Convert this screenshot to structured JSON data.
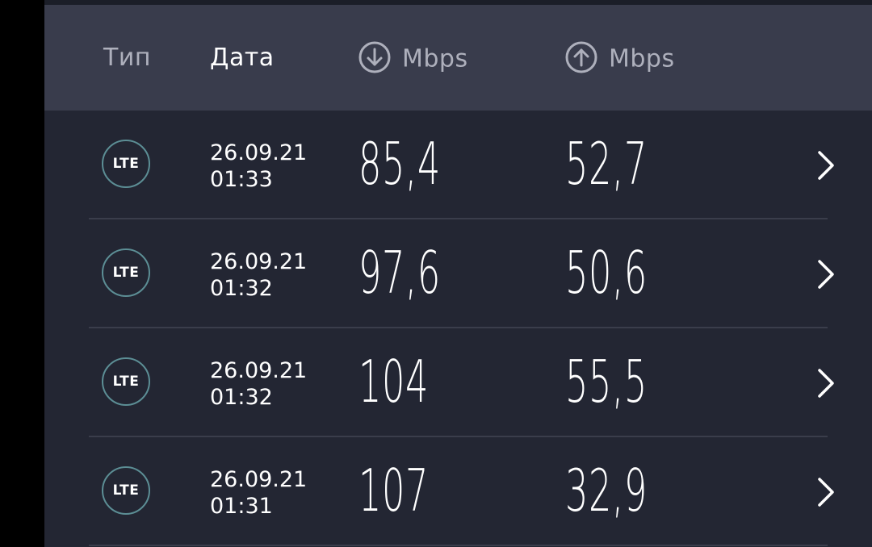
{
  "header": {
    "type_label": "Тип",
    "date_label": "Дата",
    "download_label": "Mbps",
    "download_icon": "arrow-down-circle-icon",
    "upload_label": "Mbps",
    "upload_icon": "arrow-up-circle-icon"
  },
  "results": [
    {
      "type": "LTE",
      "date": "26.09.21",
      "time": "01:33",
      "download": "85,4",
      "upload": "52,7"
    },
    {
      "type": "LTE",
      "date": "26.09.21",
      "time": "01:32",
      "download": "97,6",
      "upload": "50,6"
    },
    {
      "type": "LTE",
      "date": "26.09.21",
      "time": "01:32",
      "download": "104",
      "upload": "55,5"
    },
    {
      "type": "LTE",
      "date": "26.09.21",
      "time": "01:31",
      "download": "107",
      "upload": "32,9"
    }
  ],
  "colors": {
    "background": "#232633",
    "header": "#393c4c",
    "badge_border": "#5c8e95",
    "text": "#ffffff",
    "muted_text": "#aeb0bc"
  }
}
